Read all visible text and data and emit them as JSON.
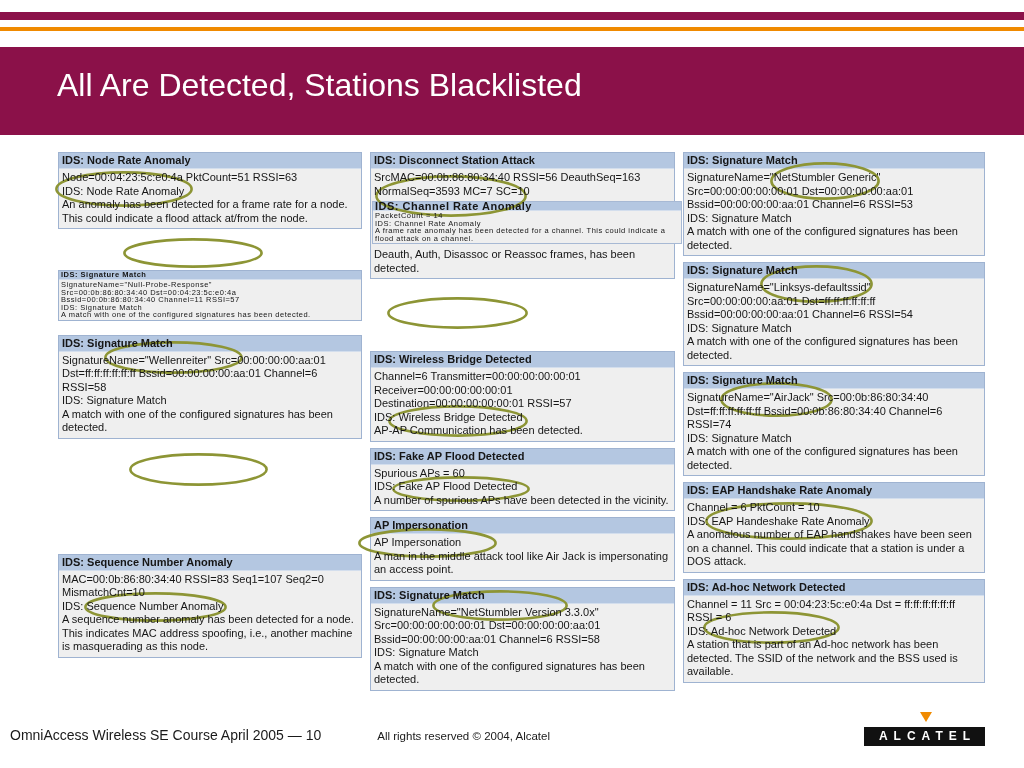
{
  "slide": {
    "title": "All Are Detected, Stations Blacklisted"
  },
  "columns": [
    {
      "cards": [
        {
          "kind": "standard",
          "title": "IDS: Node Rate Anomaly",
          "details": [
            "Node=00:04:23:5c:e0:4a PktCount=51 RSSI=63"
          ],
          "event": "IDS: Node Rate Anomaly",
          "description": "An anomaly has been detected for a frame rate for a node. This could indicate a flood attack at/from the node."
        },
        {
          "kind": "compact",
          "title": "IDS: Signature Match",
          "details": [
            "SignatureName=\"Null-Probe-Response\"",
            "Src=00:0b:86:80:34:40 Dst=00:04:23:5c:e0:4a",
            "Bssid=00:0b:86:80:34:40 Channel=11 RSSI=57"
          ],
          "event": "IDS: Signature Match",
          "description": "A match with one of the configured signatures has been detected."
        },
        {
          "kind": "standard",
          "title": "IDS: Signature Match",
          "details": [
            "SignatureName=\"Wellenreiter\" Src=00:00:00:00:aa:01",
            "Dst=ff:ff:ff:ff:ff:ff Bssid=00:00:00:00:aa:01 Channel=6",
            "RSSI=58"
          ],
          "event": "IDS: Signature Match",
          "description": "A match with one of the configured signatures has been detected."
        },
        {
          "kind": "standard",
          "title": "IDS: Sequence Number Anomaly",
          "details": [
            "MAC=00:0b:86:80:34:40 RSSI=83 Seq1=107 Seq2=0",
            "MismatchCnt=10"
          ],
          "event": "IDS: Sequence Number Anomaly",
          "description": "A sequence number anomaly has been detected for a node. This indicates MAC address spoofing, i.e., another machine is masquerading as this node."
        }
      ]
    },
    {
      "cards": [
        {
          "kind": "standard",
          "title": "IDS: Disconnect Station Attack",
          "details": [
            "SrcMAC=00:0b:86:80:34:40 RSSI=56 DeauthSeq=163",
            "NormalSeq=3593 MC=7 SC=10"
          ],
          "overlay": {
            "kind": "compact",
            "title": "IDS: Channel Rate Anomaly",
            "details": [
              "PacketCount = 14"
            ],
            "event": "IDS: Channel Rate Anomaly",
            "description": "A frame rate anomaly has been detected for a channel. This could indicate a flood attack on a channel."
          },
          "description": "Deauth, Auth, Disassoc or Reassoc frames, has been detected."
        },
        {
          "kind": "standard",
          "title": "IDS: Wireless Bridge Detected",
          "details": [
            "Channel=6 Transmitter=00:00:00:00:00:01",
            "Receiver=00:00:00:00:00:01",
            "Destination=00:00:00:00:00:01 RSSI=57"
          ],
          "event": "IDS: Wireless Bridge Detected",
          "description": "AP-AP Communication has been detected."
        },
        {
          "kind": "standard",
          "title": "IDS: Fake AP Flood Detected",
          "details": [
            "Spurious APs = 60"
          ],
          "event": "IDS: Fake AP Flood Detected",
          "description": "A number of spurious APs have been detected in the vicinity."
        },
        {
          "kind": "standard",
          "title": "AP Impersonation",
          "event": "AP Impersonation",
          "description": "A man in the middle attack tool like Air Jack is impersonating an access point."
        },
        {
          "kind": "standard",
          "title": "IDS: Signature Match",
          "details": [
            "SignatureName=\"NetStumbler Version 3.3.0x\"",
            "Src=00:00:00:00:00:01 Dst=00:00:00:00:aa:01",
            "Bssid=00:00:00:00:aa:01 Channel=6 RSSI=58"
          ],
          "event": "IDS: Signature Match",
          "description": "A match with one of the configured signatures has been detected."
        }
      ]
    },
    {
      "cards": [
        {
          "kind": "standard",
          "title": "IDS: Signature Match",
          "details": [
            "SignatureName=\"NetStumbler Generic\"",
            "Src=00:00:00:00:00:01 Dst=00:00:00:00:aa:01",
            "Bssid=00:00:00:00:aa:01 Channel=6 RSSI=53"
          ],
          "event": "IDS: Signature Match",
          "description": "A match with one of the configured signatures has been detected."
        },
        {
          "kind": "standard",
          "title": "IDS: Signature Match",
          "details": [
            "SignatureName=\"Linksys-defaultssid\"",
            "Src=00:00:00:00:aa:01 Dst=ff:ff:ff:ff:ff:ff",
            "Bssid=00:00:00:00:aa:01 Channel=6 RSSI=54"
          ],
          "event": "IDS: Signature Match",
          "description": "A match with one of the configured signatures has been detected."
        },
        {
          "kind": "standard",
          "title": "IDS: Signature Match",
          "details": [
            "SignatureName=\"AirJack\" Src=00:0b:86:80:34:40",
            "Dst=ff:ff:ff:ff:ff:ff Bssid=00:0b:86:80:34:40 Channel=6",
            "RSSI=74"
          ],
          "event": "IDS: Signature Match",
          "description": "A match with one of the configured signatures has been detected."
        },
        {
          "kind": "standard",
          "title": "IDS: EAP Handshake Rate Anomaly",
          "details": [
            "Channel = 6 PktCount = 10"
          ],
          "event": "IDS: EAP Handeshake Rate Anomaly",
          "description": "A anomalous number of EAP handshakes have been seen on a channel. This could indicate that a station is under a DOS attack."
        },
        {
          "kind": "standard",
          "title": "IDS: Ad-hoc Network Detected",
          "details": [
            "Channel = 11 Src = 00:04:23:5c:e0:4a Dst = ff:ff:ff:ff:ff:ff",
            "RSSI = 6"
          ],
          "event": "IDS: Ad-hoc Network Detected",
          "description": "A station that is part of an Ad-hoc network has been detected. The SSID of the network and the BSS used is available."
        }
      ]
    }
  ],
  "footer": {
    "course": "OmniAccess Wireless SE Course April 2005 — 10",
    "copyright": "All rights reserved © 2004, Alcatel",
    "logo": "ALCATEL"
  }
}
